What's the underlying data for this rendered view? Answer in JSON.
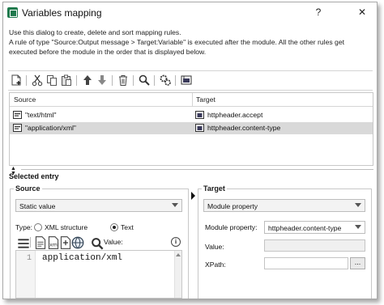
{
  "window": {
    "title": "Variables mapping",
    "help_label": "?",
    "close_label": "✕"
  },
  "description": {
    "line1": "Use this dialog to create, delete and sort mapping rules.",
    "line2": "A rule of type \"Source:Output message > Target:Variable\" is executed after the module. All the other rules get",
    "line3": "executed before the module in the order that is displayed below."
  },
  "toolbar": {
    "icons": [
      "new-rule-icon",
      "cut-icon",
      "copy-icon",
      "paste-icon",
      "move-up-icon",
      "move-down-icon",
      "delete-icon",
      "find-icon",
      "settings-icon",
      "variable-icon"
    ]
  },
  "grid": {
    "columns": [
      "Source",
      "Target"
    ],
    "rows": [
      {
        "source": "\"text/html\"",
        "target": "httpheader.accept",
        "selected": false
      },
      {
        "source": "\"application/xml\"",
        "target": "httpheader.content-type",
        "selected": true
      }
    ]
  },
  "selected_entry": {
    "label": "Selected entry",
    "source": {
      "title": "Source",
      "type_value": "Static value",
      "type_label": "Type:",
      "radio_xml_label": "XML structure",
      "radio_text_label": "Text",
      "selected_radio": "Text",
      "value_label": "Value:",
      "line_number": "1",
      "editor_text": "application/xml"
    },
    "target": {
      "title": "Target",
      "type_value": "Module property",
      "module_property_label": "Module property:",
      "module_property_value": "httpheader.content-type",
      "value_label": "Value:",
      "xpath_label": "XPath:",
      "browse_label": "..."
    }
  },
  "colors": {
    "selection": "#d9d9d9",
    "border": "#c8c8c8",
    "accent_icon": "#1f7a4d"
  }
}
